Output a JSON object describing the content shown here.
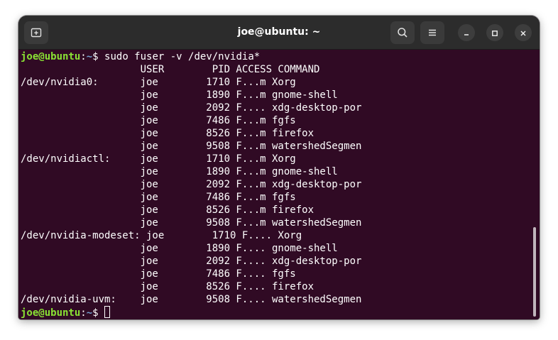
{
  "window": {
    "title": "joe@ubuntu: ~",
    "icons": {
      "new_tab": "new-tab-icon",
      "search": "search-icon",
      "menu": "hamburger-menu-icon",
      "minimize": "minimize-icon",
      "maximize": "maximize-icon",
      "close": "close-icon"
    }
  },
  "colors": {
    "terminal_bg": "#300a24",
    "prompt_user": "#8ae234",
    "prompt_path": "#729fcf",
    "text": "#ffffff",
    "titlebar_bg": "#2c2c2c"
  },
  "terminal": {
    "command": {
      "user_host": "joe@ubuntu",
      "sep": ":",
      "path": "~",
      "dollar": "$ ",
      "text": "sudo fuser -v /dev/nvidia*"
    },
    "header": "                    USER        PID ACCESS COMMAND",
    "output": [
      "/dev/nvidia0:       joe        1710 F...m Xorg",
      "                    joe        1890 F...m gnome-shell",
      "                    joe        2092 F.... xdg-desktop-por",
      "                    joe        7486 F...m fgfs",
      "                    joe        8526 F...m firefox",
      "                    joe        9508 F...m watershedSegmen",
      "/dev/nvidiactl:     joe        1710 F...m Xorg",
      "                    joe        1890 F...m gnome-shell",
      "                    joe        2092 F...m xdg-desktop-por",
      "                    joe        7486 F...m fgfs",
      "                    joe        8526 F...m firefox",
      "                    joe        9508 F...m watershedSegmen",
      "/dev/nvidia-modeset: joe        1710 F.... Xorg",
      "                    joe        1890 F.... gnome-shell",
      "                    joe        2092 F.... xdg-desktop-por",
      "                    joe        7486 F.... fgfs",
      "                    joe        8526 F.... firefox",
      "/dev/nvidia-uvm:    joe        9508 F.... watershedSegmen"
    ],
    "final_prompt": {
      "user_host": "joe@ubuntu",
      "sep": ":",
      "path": "~",
      "dollar": "$ "
    }
  }
}
